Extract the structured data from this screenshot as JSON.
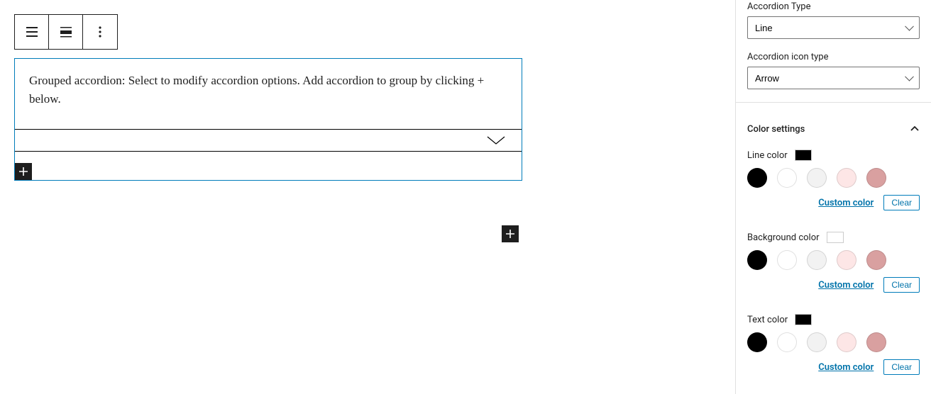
{
  "canvas": {
    "hint": "Grouped accordion: Select to modify accordion options. Add accordion to group by clicking + below."
  },
  "sidebar": {
    "accordion_type": {
      "label": "Accordion Type",
      "value": "Line"
    },
    "icon_type": {
      "label": "Accordion icon type",
      "value": "Arrow"
    },
    "color_panel": {
      "title": "Color settings"
    },
    "line_color": {
      "label": "Line color",
      "preview": "#000000"
    },
    "bg_color": {
      "label": "Background color",
      "preview": "#ffffff"
    },
    "text_color": {
      "label": "Text color",
      "preview": "#000000"
    },
    "swatches": [
      "#000000",
      "#ffffff",
      "#f2f2f2",
      "#fde6e6",
      "#d9a0a0"
    ],
    "custom": "Custom color",
    "clear": "Clear"
  }
}
